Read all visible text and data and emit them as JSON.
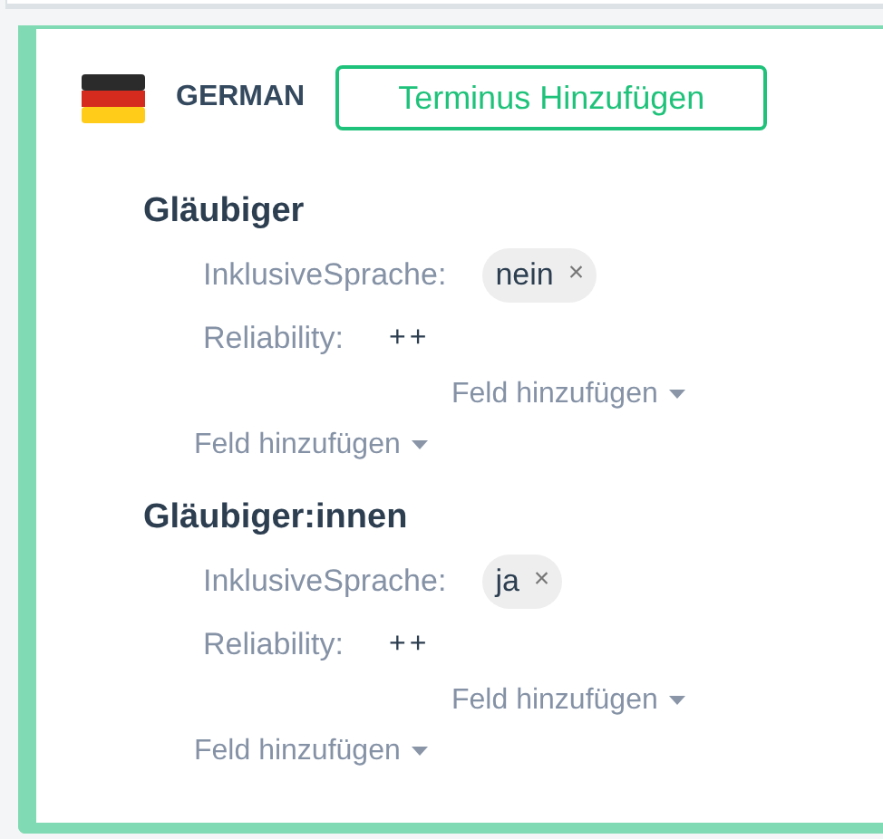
{
  "language": {
    "name": "GERMAN"
  },
  "add_term_button": "Terminus Hinzufügen",
  "terms": [
    {
      "term": "Gläubiger",
      "fields": [
        {
          "label": "InklusiveSprache:",
          "kind": "tag",
          "value": "nein",
          "remove": "×"
        },
        {
          "label": "Reliability:",
          "kind": "text",
          "value": "++"
        }
      ],
      "add_field_inner": "Feld hinzufügen",
      "add_field_outer": "Feld hinzufügen"
    },
    {
      "term": "Gläubiger:innen",
      "fields": [
        {
          "label": "InklusiveSprache:",
          "kind": "tag",
          "value": "ja",
          "remove": "×"
        },
        {
          "label": "Reliability:",
          "kind": "text",
          "value": "++"
        }
      ],
      "add_field_inner": "Feld hinzufügen",
      "add_field_outer": "Feld hinzufügen"
    }
  ]
}
